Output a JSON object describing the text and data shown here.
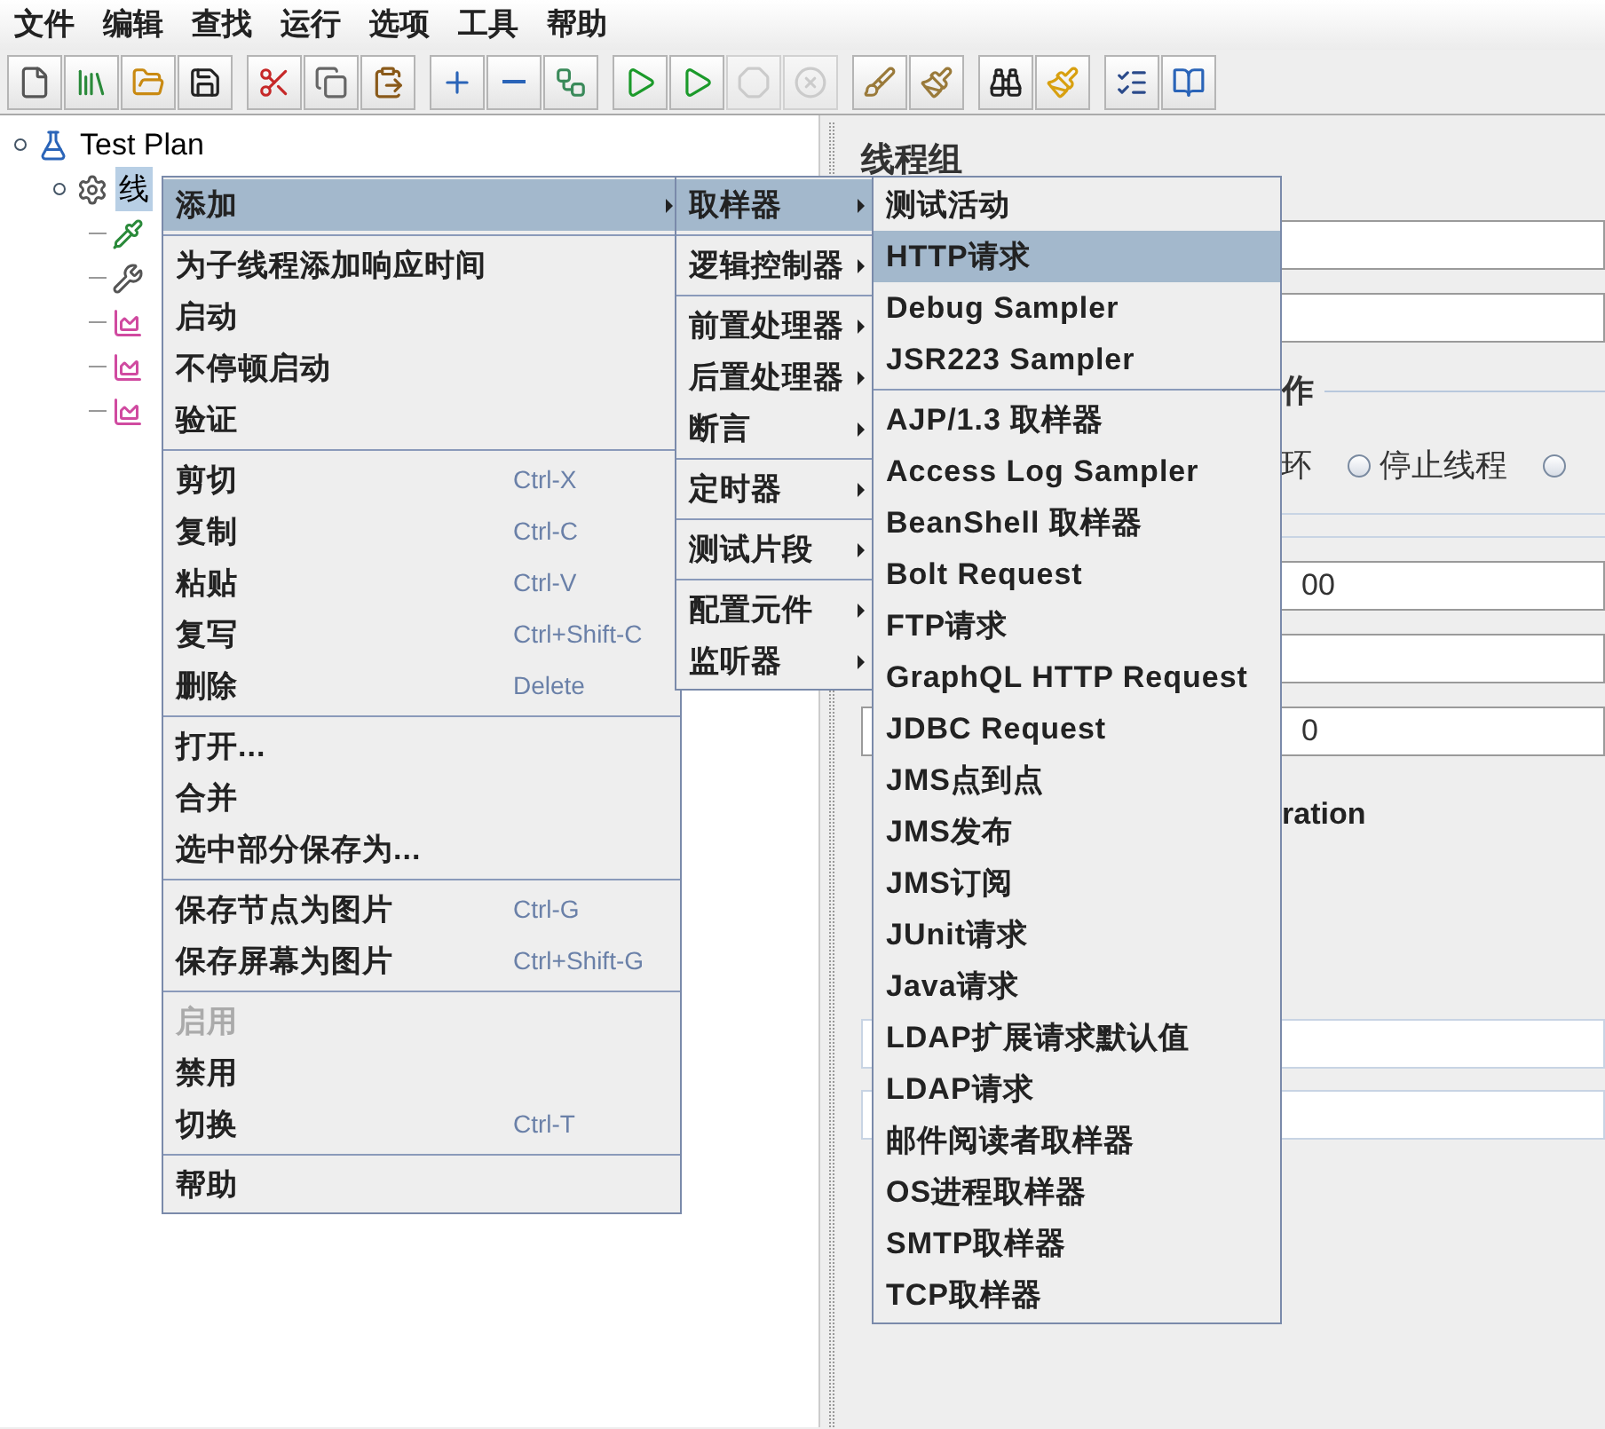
{
  "menubar": [
    {
      "label": "文件"
    },
    {
      "label": "编辑"
    },
    {
      "label": "查找"
    },
    {
      "label": "运行"
    },
    {
      "label": "选项"
    },
    {
      "label": "工具"
    },
    {
      "label": "帮助"
    }
  ],
  "toolbar": [
    [
      {
        "kind": "new",
        "disabled": false
      },
      {
        "kind": "templates",
        "disabled": false
      },
      {
        "kind": "open",
        "disabled": false
      },
      {
        "kind": "save",
        "disabled": false
      }
    ],
    [
      {
        "kind": "cut",
        "disabled": false
      },
      {
        "kind": "copy",
        "disabled": false
      },
      {
        "kind": "paste",
        "disabled": false
      }
    ],
    [
      {
        "kind": "expand",
        "disabled": false
      },
      {
        "kind": "collapse",
        "disabled": false
      },
      {
        "kind": "toggle",
        "disabled": false
      }
    ],
    [
      {
        "kind": "start",
        "disabled": false
      },
      {
        "kind": "start_no_pause",
        "disabled": false
      },
      {
        "kind": "stop",
        "disabled": true
      },
      {
        "kind": "shutdown",
        "disabled": true
      }
    ],
    [
      {
        "kind": "clear",
        "disabled": false
      },
      {
        "kind": "clear_all",
        "disabled": false
      }
    ],
    [
      {
        "kind": "search",
        "disabled": false
      },
      {
        "kind": "reset_search",
        "disabled": false
      }
    ],
    [
      {
        "kind": "functions",
        "disabled": false
      },
      {
        "kind": "help",
        "disabled": false
      }
    ]
  ],
  "tree": {
    "label": "Test Plan",
    "kind": "plan",
    "selected": false,
    "children": [
      {
        "label": "线",
        "kind": "threads",
        "selected": true,
        "children": [
          {
            "kind": "dropper"
          },
          {
            "kind": "tools"
          },
          {
            "kind": "graph"
          },
          {
            "kind": "graph"
          },
          {
            "kind": "graph"
          }
        ]
      }
    ]
  },
  "panel": {
    "title": "线程组",
    "rows": [
      {
        "kind": "field"
      },
      {
        "kind": "field"
      },
      {
        "kind": "group",
        "label": "作"
      },
      {
        "kind": "radios",
        "radios": [
          {
            "label": "环"
          },
          {
            "label": "停止线程",
            "selected": false
          },
          {
            "selected": false
          }
        ]
      },
      {
        "kind": "rule"
      },
      {
        "kind": "rule"
      },
      {
        "kind": "field",
        "value": "00"
      },
      {
        "kind": "field"
      },
      {
        "kind": "field",
        "value": "0"
      },
      {
        "kind": "label",
        "label": "ration"
      },
      {
        "kind": "spacer"
      },
      {
        "kind": "light_field"
      },
      {
        "kind": "light_field"
      }
    ]
  },
  "context_menu": {
    "sections": [
      [
        {
          "label": "添加",
          "selected": true,
          "submenu": true
        }
      ],
      [
        {
          "label": "为子线程添加响应时间"
        },
        {
          "label": "启动"
        },
        {
          "label": "不停顿启动"
        },
        {
          "label": "验证"
        }
      ],
      [
        {
          "label": "剪切",
          "shortcut": "Ctrl-X"
        },
        {
          "label": "复制",
          "shortcut": "Ctrl-C"
        },
        {
          "label": "粘贴",
          "shortcut": "Ctrl-V"
        },
        {
          "label": "复写",
          "shortcut": "Ctrl+Shift-C"
        },
        {
          "label": "删除",
          "shortcut": "Delete"
        }
      ],
      [
        {
          "label": "打开..."
        },
        {
          "label": "合并"
        },
        {
          "label": "选中部分保存为..."
        }
      ],
      [
        {
          "label": "保存节点为图片",
          "shortcut": "Ctrl-G"
        },
        {
          "label": "保存屏幕为图片",
          "shortcut": "Ctrl+Shift-G"
        }
      ],
      [
        {
          "label": "启用",
          "disabled": true
        },
        {
          "label": "禁用"
        },
        {
          "label": "切换",
          "shortcut": "Ctrl-T"
        }
      ],
      [
        {
          "label": "帮助"
        }
      ]
    ]
  },
  "add_menu": {
    "sections": [
      [
        {
          "label": "取样器",
          "selected": true,
          "submenu": true
        }
      ],
      [
        {
          "label": "逻辑控制器",
          "submenu": true
        }
      ],
      [
        {
          "label": "前置处理器",
          "submenu": true
        },
        {
          "label": "后置处理器",
          "submenu": true
        },
        {
          "label": "断言",
          "submenu": true
        }
      ],
      [
        {
          "label": "定时器",
          "submenu": true
        }
      ],
      [
        {
          "label": "测试片段",
          "submenu": true
        }
      ],
      [
        {
          "label": "配置元件",
          "submenu": true
        },
        {
          "label": "监听器",
          "submenu": true
        }
      ]
    ]
  },
  "sampler_menu": {
    "sections": [
      [
        {
          "label": "测试活动"
        },
        {
          "label": "HTTP请求",
          "selected": true
        },
        {
          "label": "Debug Sampler"
        },
        {
          "label": "JSR223 Sampler"
        }
      ],
      [
        {
          "label": "AJP/1.3 取样器"
        },
        {
          "label": "Access Log Sampler"
        },
        {
          "label": "BeanShell 取样器"
        },
        {
          "label": "Bolt Request"
        },
        {
          "label": "FTP请求"
        },
        {
          "label": "GraphQL HTTP Request"
        },
        {
          "label": "JDBC Request"
        },
        {
          "label": "JMS点到点"
        },
        {
          "label": "JMS发布"
        },
        {
          "label": "JMS订阅"
        },
        {
          "label": "JUnit请求"
        },
        {
          "label": "Java请求"
        },
        {
          "label": "LDAP扩展请求默认值"
        },
        {
          "label": "LDAP请求"
        },
        {
          "label": "邮件阅读者取样器"
        },
        {
          "label": "OS进程取样器"
        },
        {
          "label": "SMTP取样器"
        },
        {
          "label": "TCP取样器"
        }
      ]
    ]
  }
}
